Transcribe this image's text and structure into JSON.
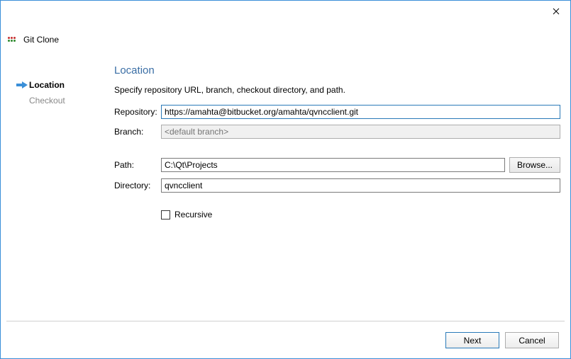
{
  "window": {
    "title": "Git Clone"
  },
  "sidebar": {
    "items": [
      {
        "label": "Location",
        "active": true
      },
      {
        "label": "Checkout",
        "active": false
      }
    ]
  },
  "section": {
    "title": "Location",
    "description": "Specify repository URL, branch, checkout directory, and path."
  },
  "form": {
    "repository_label": "Repository:",
    "repository_value": "https://amahta@bitbucket.org/amahta/qvncclient.git",
    "branch_label": "Branch:",
    "branch_placeholder": "<default branch>",
    "branch_value": "",
    "path_label": "Path:",
    "path_value": "C:\\Qt\\Projects",
    "browse_label": "Browse...",
    "directory_label": "Directory:",
    "directory_value": "qvncclient",
    "recursive_label": "Recursive",
    "recursive_checked": false
  },
  "footer": {
    "next_label": "Next",
    "cancel_label": "Cancel"
  }
}
